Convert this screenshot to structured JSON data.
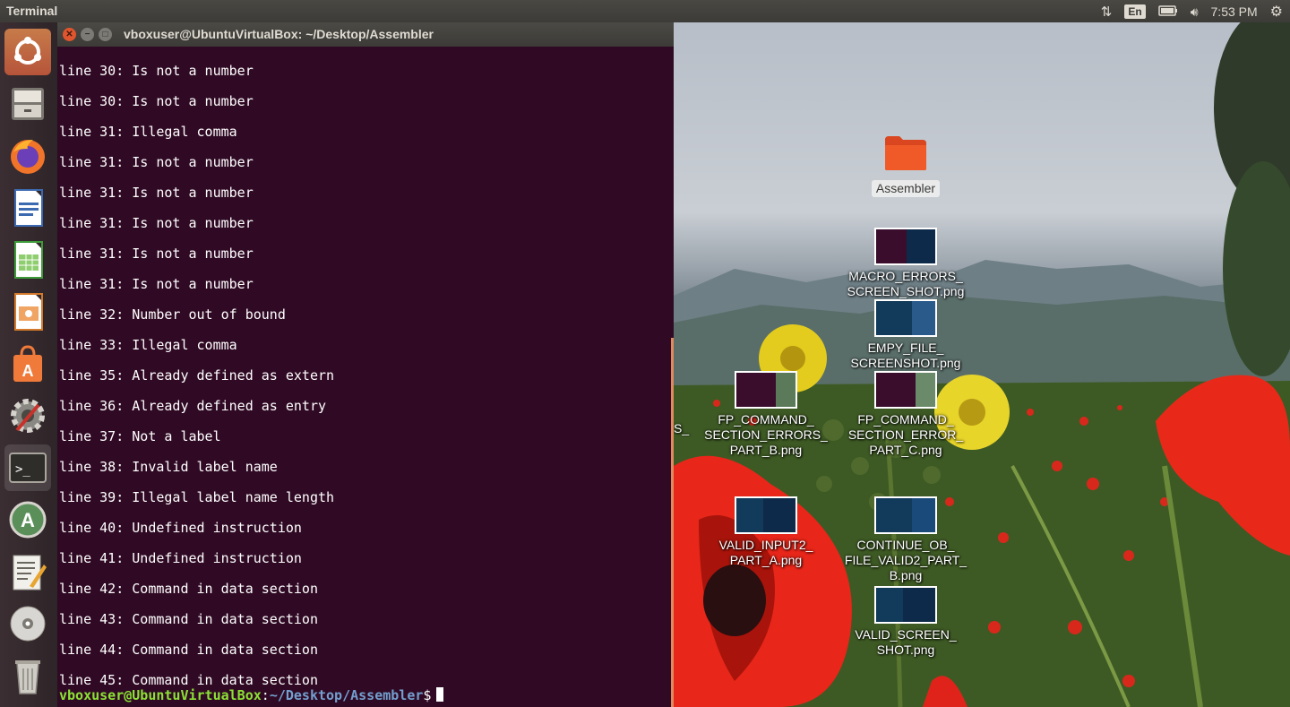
{
  "top_panel": {
    "app_name": "Terminal",
    "language": "En",
    "time": "7:53 PM"
  },
  "launcher": {
    "items": [
      {
        "name": "Ubuntu Dash",
        "icon": "ubuntu-logo-icon"
      },
      {
        "name": "Files",
        "icon": "file-cabinet-icon"
      },
      {
        "name": "Firefox",
        "icon": "firefox-icon"
      },
      {
        "name": "LibreOffice Writer",
        "icon": "writer-document-icon"
      },
      {
        "name": "LibreOffice Calc",
        "icon": "calc-spreadsheet-icon"
      },
      {
        "name": "LibreOffice Impress",
        "icon": "impress-presentation-icon"
      },
      {
        "name": "Ubuntu Software",
        "icon": "software-bag-icon"
      },
      {
        "name": "System Settings",
        "icon": "settings-gear-icon"
      },
      {
        "name": "Terminal",
        "icon": "terminal-icon"
      },
      {
        "name": "Software Updater",
        "icon": "software-updater-icon"
      },
      {
        "name": "Text Editor",
        "icon": "text-editor-icon"
      },
      {
        "name": "DVD Drive",
        "icon": "disc-icon"
      },
      {
        "name": "Trash",
        "icon": "trash-icon"
      }
    ]
  },
  "terminal": {
    "title": "vboxuser@UbuntuVirtualBox: ~/Desktop/Assembler",
    "lines": [
      "line 30: Is not a number",
      "line 30: Is not a number",
      "line 31: Illegal comma",
      "line 31: Is not a number",
      "line 31: Is not a number",
      "line 31: Is not a number",
      "line 31: Is not a number",
      "line 31: Is not a number",
      "line 32: Number out of bound",
      "line 33: Illegal comma",
      "line 35: Already defined as extern",
      "line 36: Already defined as entry",
      "line 37: Not a label",
      "line 38: Invalid label name",
      "line 39: Illegal label name length",
      "line 40: Undefined instruction",
      "line 41: Undefined instruction",
      "line 42: Command in data section",
      "line 43: Command in data section",
      "line 44: Command in data section",
      "line 45: Command in data section"
    ],
    "prompt_user": "vboxuser@UbuntuVirtualBox",
    "prompt_sep": ":",
    "prompt_path": "~/Desktop/Assembler",
    "prompt_symbol": "$"
  },
  "desktop": {
    "folder": {
      "label": "Assembler"
    },
    "files": [
      {
        "label": "MACRO_ERRORS_ SCREEN_SHOT.png",
        "icon": "png-thumbnail-icon"
      },
      {
        "label": "EMPY_FILE_ SCREENSHOT.png",
        "icon": "png-thumbnail-icon"
      },
      {
        "label": "FP_COMMAND_ SECTION_ERRORS_ PART_B.png",
        "icon": "png-thumbnail-icon"
      },
      {
        "label": "FP_COMMAND_ SECTION_ERROR_ PART_C.png",
        "icon": "png-thumbnail-icon"
      },
      {
        "label": "VALID_INPUT2_ PART_A.png",
        "icon": "png-thumbnail-icon"
      },
      {
        "label": "CONTINUE_OB_ FILE_VALID2_PART_ B.png",
        "icon": "png-thumbnail-icon"
      },
      {
        "label": "VALID_SCREEN_ SHOT.png",
        "icon": "png-thumbnail-icon"
      },
      {
        "label": "S_",
        "icon": "png-thumbnail-icon"
      }
    ]
  },
  "colors": {
    "terminal_bg": "#300a24",
    "prompt_user": "#8ae234",
    "prompt_path": "#729fcf",
    "close_button": "#e0552d"
  }
}
